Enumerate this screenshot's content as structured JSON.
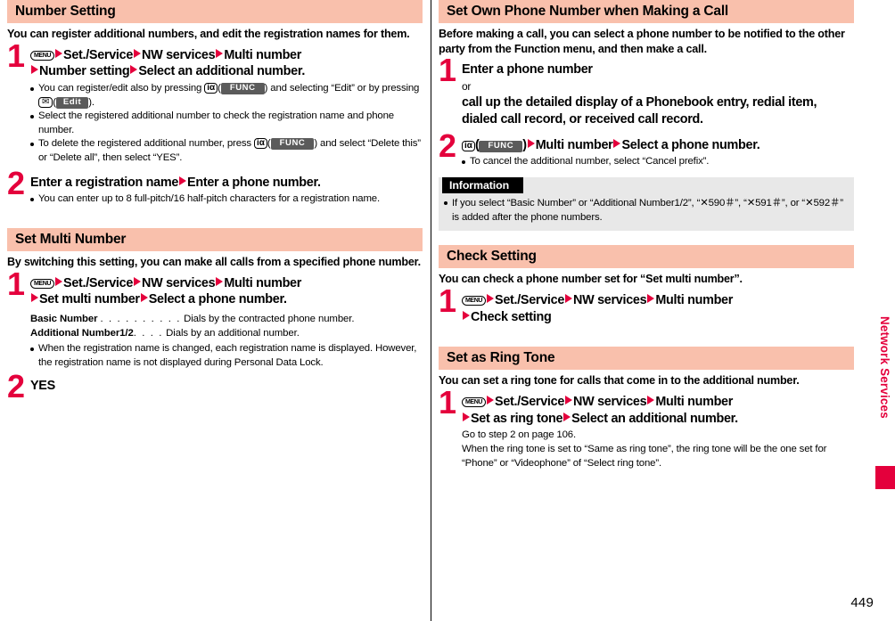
{
  "page": {
    "number": "449",
    "side_label": "Network Services"
  },
  "left_column": {
    "sections": [
      {
        "title": "Number Setting",
        "intro": "You can register additional numbers, and edit the registration names for them.",
        "steps": [
          {
            "num": "1",
            "line1_a": "Set./Service",
            "line1_b": "NW services",
            "line1_c": "Multi number",
            "line2_a": "Number setting",
            "line2_b": "Select an additional number.",
            "menu_key": "MENU",
            "notes": [
              {
                "seg1": "You can register/edit also by pressing ",
                "key1": "iα",
                "soft1": "FUNC",
                "seg2": " and selecting “Edit” or by pressing ",
                "key2": "✉",
                "soft2": "Edit",
                "seg3": "."
              },
              {
                "text": "Select the registered additional number to check the registration name and phone number."
              },
              {
                "seg1": "To delete the registered additional number, press ",
                "key1": "iα",
                "soft1": "FUNC",
                "seg2": " and select “Delete this” or “Delete all”, then select “YES”."
              }
            ]
          },
          {
            "num": "2",
            "title_a": "Enter a registration name",
            "title_b": "Enter a phone number.",
            "notes": [
              {
                "text": "You can enter up to 8 full-pitch/16 half-pitch characters for a registration name."
              }
            ]
          }
        ]
      },
      {
        "title": "Set Multi Number",
        "intro": "By switching this setting, you can make all calls from a specified phone number.",
        "steps": [
          {
            "num": "1",
            "line1_a": "Set./Service",
            "line1_b": "NW services",
            "line1_c": "Multi number",
            "line2_a": "Set multi number",
            "line2_b": "Select a phone number.",
            "menu_key": "MENU"
          },
          {
            "num": "2",
            "title_a": "YES"
          }
        ],
        "deflist": [
          {
            "term": "Basic Number",
            "dots": ". . . . . . . . . .",
            "desc": "Dials by the contracted phone number."
          },
          {
            "term": "Additional Number1/2",
            "dots": ". . . .",
            "desc": "Dials by an additional number."
          }
        ],
        "deflist_notes": [
          {
            "text": "When the registration name is changed, each registration name is displayed. However, the registration name is not displayed during Personal Data Lock."
          }
        ]
      }
    ]
  },
  "right_column": {
    "sections": [
      {
        "title": "Set Own Phone Number when Making a Call",
        "intro": "Before making a call, you can select a phone number to be notified to the other party from the Function menu, and then make a call.",
        "steps": [
          {
            "num": "1",
            "title_a": "Enter a phone number",
            "or": "or",
            "title_b": "call up the detailed display of a Phonebook entry, redial item, dialed call record, or received call record."
          },
          {
            "num": "2",
            "key1": "iα",
            "soft1": "FUNC",
            "title_a": "Multi number",
            "title_b": "Select a phone number.",
            "notes": [
              {
                "text": "To cancel the additional number, select “Cancel prefix”."
              }
            ]
          }
        ],
        "information": {
          "heading": "Information",
          "notes": [
            {
              "text": "If you select “Basic Number” or “Additional Number1/2”, “✕590＃”, “✕591＃”, or “✕592＃” is added after the phone numbers."
            }
          ]
        }
      },
      {
        "title": "Check Setting",
        "intro": "You can check a phone number set for “Set multi number”.",
        "steps": [
          {
            "num": "1",
            "line1_a": "Set./Service",
            "line1_b": "NW services",
            "line1_c": "Multi number",
            "line2_a": "Check setting",
            "menu_key": "MENU"
          }
        ]
      },
      {
        "title": "Set as Ring Tone",
        "intro": "You can set a ring tone for calls that come in to the additional number.",
        "steps": [
          {
            "num": "1",
            "line1_a": "Set./Service",
            "line1_b": "NW services",
            "line1_c": "Multi number",
            "line2_a": "Set as ring tone",
            "line2_b": "Select an additional number.",
            "menu_key": "MENU",
            "plain_notes": [
              "Go to step 2 on page 106.",
              "When the ring tone is set to “Same as ring tone”, the ring tone will be the one set for “Phone” or “Videophone” of “Select ring tone”."
            ]
          }
        ]
      }
    ]
  }
}
